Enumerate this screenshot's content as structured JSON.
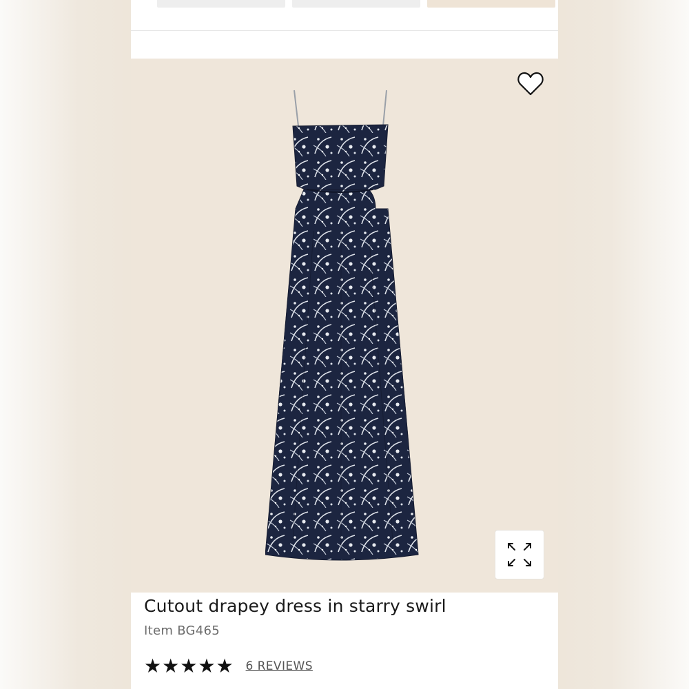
{
  "product": {
    "title": "Cutout drapey dress in starry swirl",
    "item_number": "Item BG465",
    "rating": 5,
    "max_rating": 5,
    "stars": [
      "★",
      "★",
      "★",
      "★",
      "★"
    ],
    "reviews_label": "6 REVIEWS"
  },
  "icons": {
    "wishlist": "heart-outline-icon",
    "expand": "expand-arrows-icon"
  },
  "colors": {
    "image_background": "#efe6da",
    "dress": "#1c2540",
    "text": "#1a1a1a"
  }
}
